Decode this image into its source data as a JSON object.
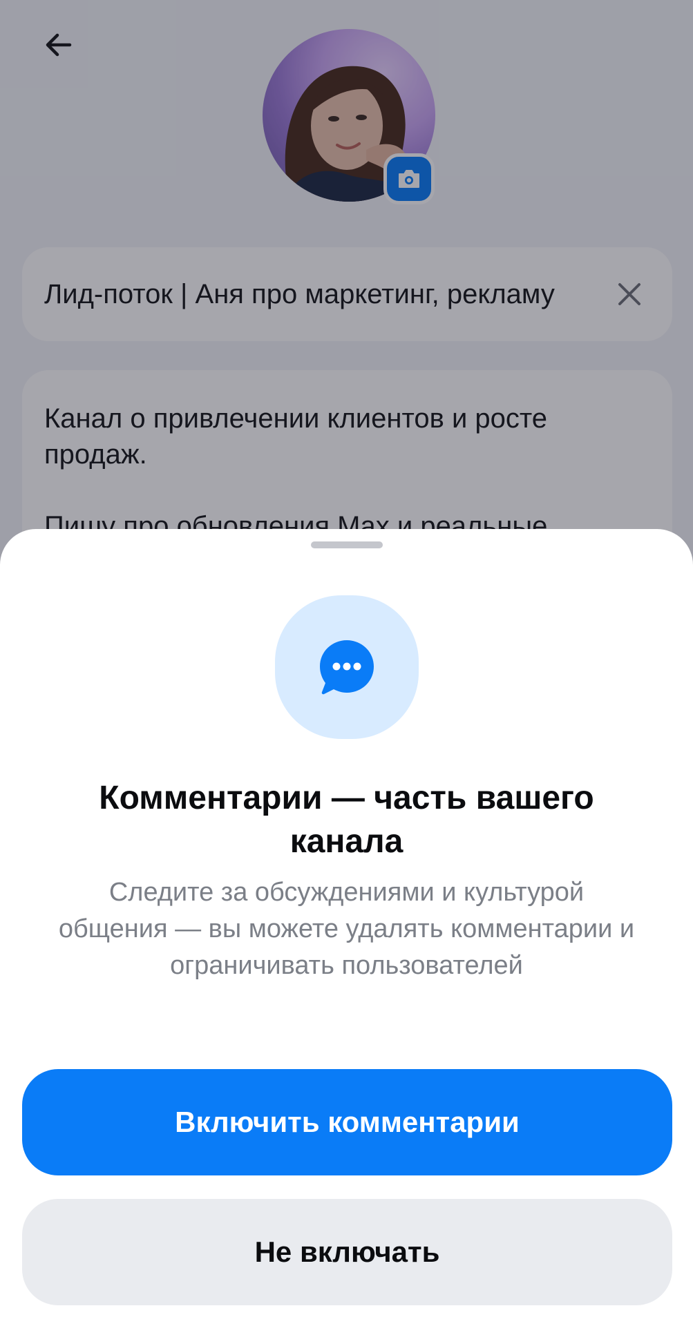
{
  "channel": {
    "name_value": "Лид-поток | Аня про маркетинг, рекламу",
    "description_value": "Канал о привлечении клиентов и росте продаж.\n\nПишу про обновления Max и реальные"
  },
  "sheet": {
    "title": "Комментарии — часть вашего канала",
    "description": "Следите за обсуждениями и культурой общения — вы можете удалять комментарии и ограничивать пользователей",
    "enable_label": "Включить комментарии",
    "skip_label": "Не включать"
  },
  "icons": {
    "back": "arrow-left-icon",
    "camera": "camera-icon",
    "clear": "close-icon",
    "comments": "chat-bubble-dots-icon"
  },
  "colors": {
    "accent": "#0a7cf7",
    "icon_bg": "#d8ebff",
    "secondary_button_bg": "#e9ebef",
    "muted_text": "#7b7f87"
  }
}
